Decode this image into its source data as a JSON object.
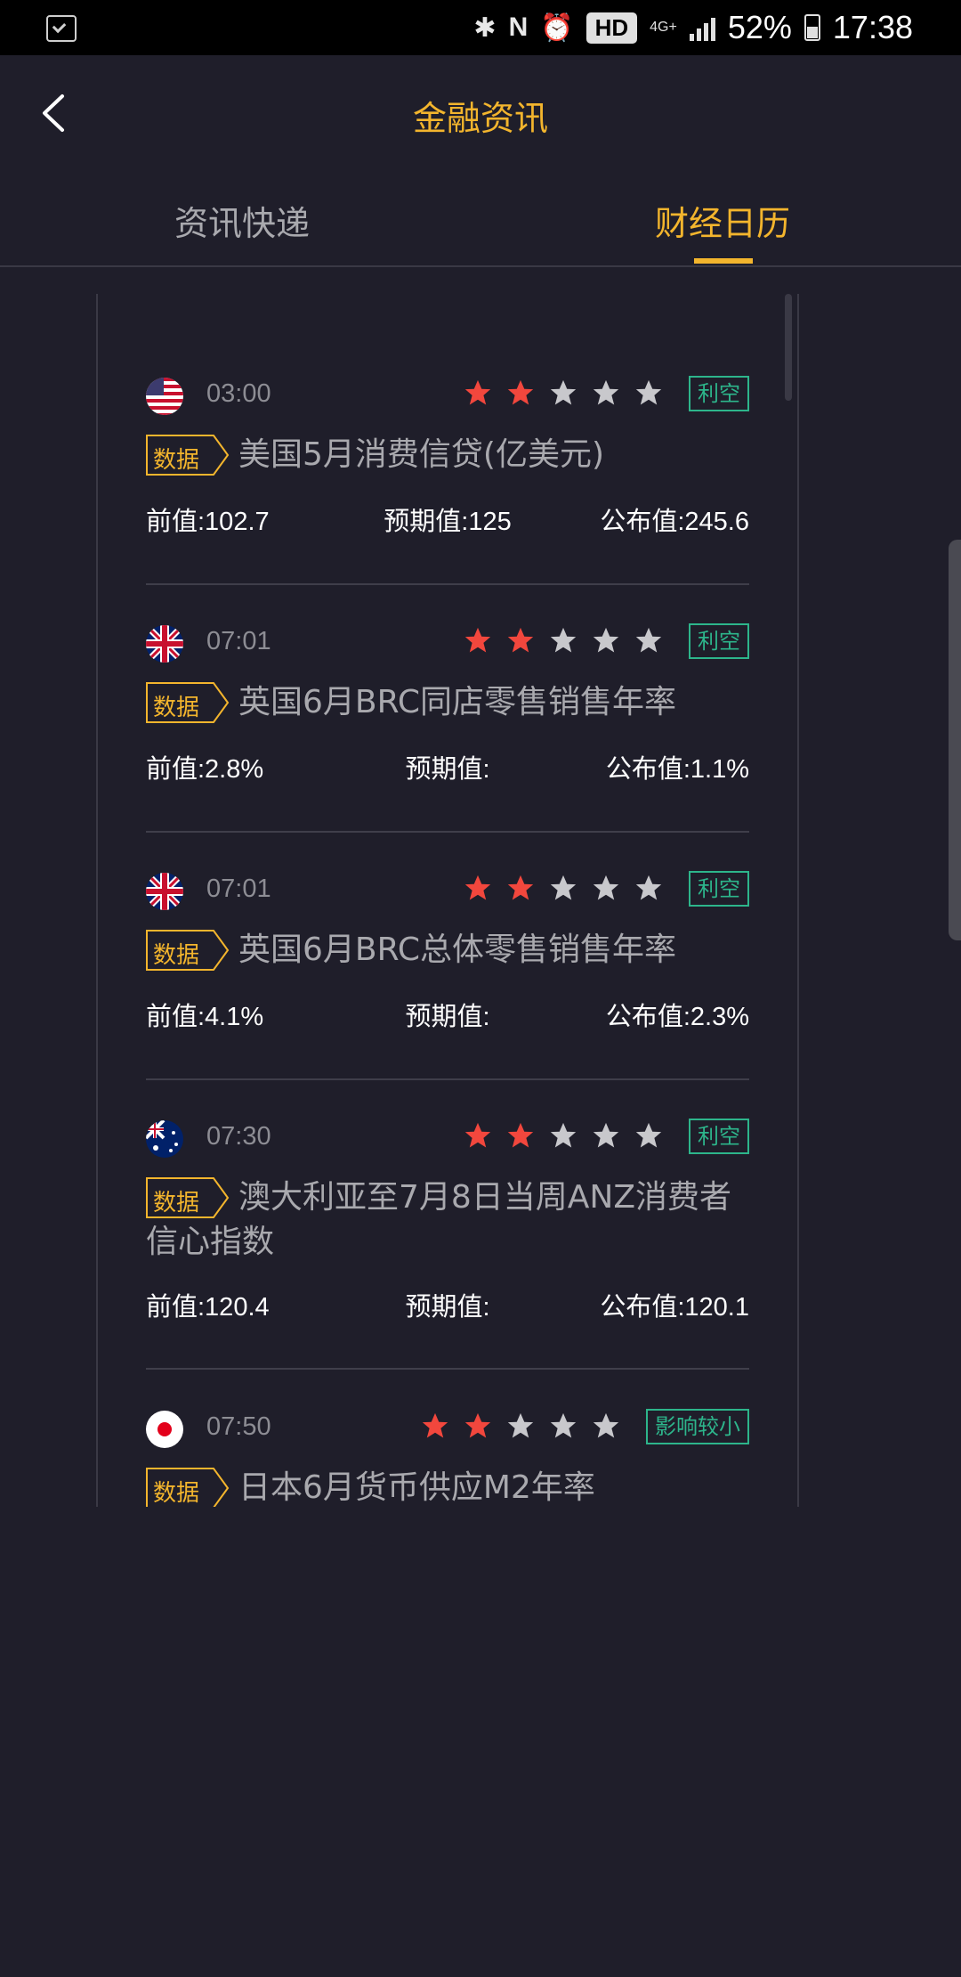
{
  "statusbar": {
    "network": "4G+",
    "hd": "HD",
    "battery_pct": "52%",
    "time": "17:38"
  },
  "header": {
    "title": "金融资讯"
  },
  "tabs": [
    {
      "label": "资讯快递",
      "active": false
    },
    {
      "label": "财经日历",
      "active": true
    }
  ],
  "colors": {
    "background": "#1f1e2a",
    "accent": "#f3b52d",
    "star_active": "#f2473d",
    "star_inactive": "#c8c8cc",
    "impact": "#2db58b"
  },
  "events": [
    {
      "flag": "us-flag-icon",
      "time": "03:00",
      "stars": 2,
      "impact": "利空",
      "tag": "数据",
      "title": "美国5月消费信贷(亿美元)",
      "prev": "前值:102.7",
      "expected": "预期值:125",
      "actual": "公布值:245.6"
    },
    {
      "flag": "uk-flag-icon",
      "time": "07:01",
      "stars": 2,
      "impact": "利空",
      "tag": "数据",
      "title": "英国6月BRC同店零售销售年率",
      "prev": "前值:2.8%",
      "expected": "预期值:",
      "actual": "公布值:1.1%"
    },
    {
      "flag": "uk-flag-icon",
      "time": "07:01",
      "stars": 2,
      "impact": "利空",
      "tag": "数据",
      "title": "英国6月BRC总体零售销售年率",
      "prev": "前值:4.1%",
      "expected": "预期值:",
      "actual": "公布值:2.3%"
    },
    {
      "flag": "au-flag-icon",
      "time": "07:30",
      "stars": 2,
      "impact": "利空",
      "tag": "数据",
      "title": "澳大利亚至7月8日当周ANZ消费者信心指数",
      "prev": "前值:120.4",
      "expected": "预期值:",
      "actual": "公布值:120.1"
    },
    {
      "flag": "jp-flag-icon",
      "time": "07:50",
      "stars": 2,
      "impact": "影响较小",
      "tag": "数据",
      "title": "日本6月货币供应M2年率"
    }
  ]
}
